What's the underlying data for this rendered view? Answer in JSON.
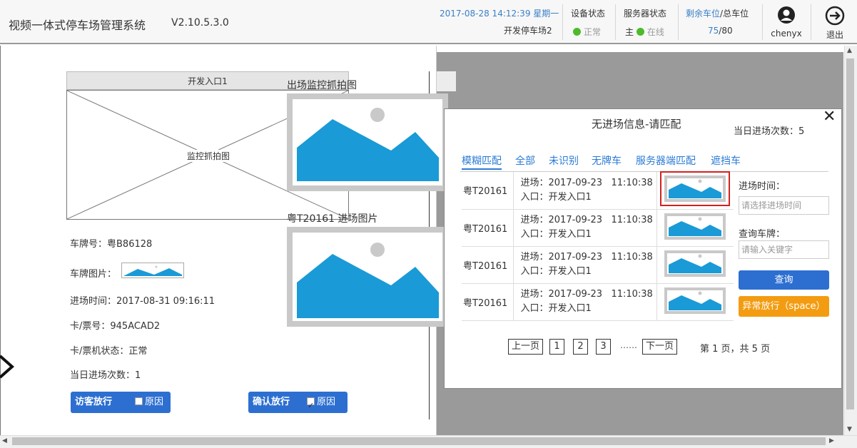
{
  "header": {
    "title": "视频一体式停车场管理系统",
    "version": "V2.10.5.3.0",
    "datetime": "2017-08-28 14:12:39 星期一",
    "lot_name": "开发停车场2",
    "device_status_label": "设备状态",
    "device_status_value": "正常",
    "server_status_label": "服务器状态",
    "server_role": "主",
    "server_status_value": "在线",
    "spaces_label_left": "剩余车位",
    "spaces_label_sep": "/",
    "spaces_label_total": "总车位",
    "spaces_left": "75",
    "spaces_total": "/80",
    "user": "chenyx",
    "logout": "退出"
  },
  "left_panel": {
    "entrance_tab": "开发入口1",
    "capture_label": "监控抓拍图",
    "exit_capture_label": "出场监控抓拍图",
    "entry_image_label": "粤T20161 进场图片",
    "plate_no": "车牌号：粤B86128",
    "plate_image": "车牌图片：",
    "entry_time": "进场时间：2017-08-31 09:16:11",
    "card_no": "卡/票号：945ACAD2",
    "card_status": "卡/票机状态：正常",
    "today_entries": "当日进场次数：1",
    "visitor_release": "访客放行",
    "confirm_release": "确认放行",
    "reason": "原因"
  },
  "dialog": {
    "title": "无进场信息-请匹配",
    "close": "✕",
    "today_count": "当日进场次数：5",
    "tabs": [
      "模糊匹配",
      "全部",
      "未识别",
      "无牌车",
      "服务器端匹配",
      "遮挡车"
    ],
    "records": [
      {
        "plate": "粤T20161",
        "entry_time": "进场：2017-09-23   11:10:38",
        "entrance": "入口：开发入口1"
      },
      {
        "plate": "粤T20161",
        "entry_time": "进场：2017-09-23   11:10:38",
        "entrance": "入口：开发入口1"
      },
      {
        "plate": "粤T20161",
        "entry_time": "进场：2017-09-23   11:10:38",
        "entrance": "入口：开发入口1"
      },
      {
        "plate": "粤T20161",
        "entry_time": "进场：2017-09-23   11:10:38",
        "entrance": "入口：开发入口1"
      }
    ],
    "entry_time_label": "进场时间：",
    "entry_time_placeholder": "请选择进场时间",
    "plate_query_label": "查询车牌：",
    "plate_query_placeholder": "请输入关键字",
    "query_button": "查询",
    "abnormal_button": "异常放行（space）",
    "pagination": {
      "prev": "上一页",
      "pages": [
        "1",
        "2",
        "3"
      ],
      "ellipsis": "……",
      "next": "下一页",
      "summary": "第 1 页，共 5 页"
    }
  },
  "colors": {
    "accent": "#2d6fd1",
    "warning": "#f39c12",
    "status_ok": "#4cbb2b",
    "image_blue": "#1a9ad6",
    "selection": "#d42020"
  }
}
